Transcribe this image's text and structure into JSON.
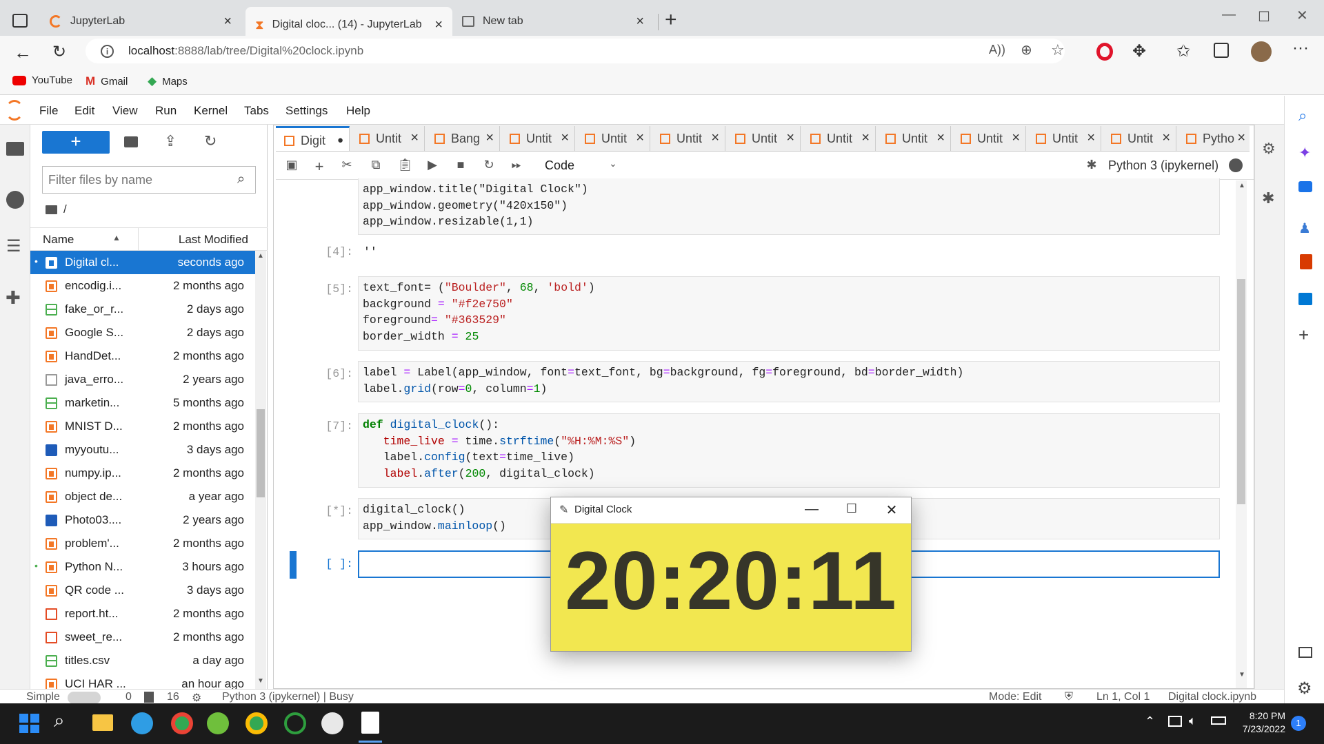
{
  "browser": {
    "tabs": [
      {
        "title": "JupyterLab",
        "close": "×"
      },
      {
        "title": "Digital cloc... (14) - JupyterLab",
        "close": "×"
      },
      {
        "title": "New tab",
        "close": "×"
      }
    ],
    "new_tab": "+",
    "address": {
      "host": "localhost",
      "path": ":8888/lab/tree/Digital%20clock.ipynb"
    },
    "bookmarks": [
      "YouTube",
      "Gmail",
      "Maps"
    ],
    "window_controls": {
      "minimize": "—",
      "maximize": "☐",
      "close": "✕"
    }
  },
  "menubar": [
    "File",
    "Edit",
    "View",
    "Run",
    "Kernel",
    "Tabs",
    "Settings",
    "Help"
  ],
  "filebrowser": {
    "new_button": "+",
    "filter_placeholder": "Filter files by name",
    "path": "/",
    "col_name": "Name",
    "col_modified": "Last Modified",
    "files": [
      {
        "name": "Digital cl...",
        "modified": "seconds ago",
        "type": "nb",
        "running": true,
        "selected": true
      },
      {
        "name": "encodig.i...",
        "modified": "2 months ago",
        "type": "nb"
      },
      {
        "name": "fake_or_r...",
        "modified": "2 days ago",
        "type": "csv"
      },
      {
        "name": "Google S...",
        "modified": "2 days ago",
        "type": "nb"
      },
      {
        "name": "HandDet...",
        "modified": "2 months ago",
        "type": "nb"
      },
      {
        "name": "java_erro...",
        "modified": "2 years ago",
        "type": "txt"
      },
      {
        "name": "marketin...",
        "modified": "5 months ago",
        "type": "csv"
      },
      {
        "name": "MNIST D...",
        "modified": "2 months ago",
        "type": "nb"
      },
      {
        "name": "myyoutu...",
        "modified": "3 days ago",
        "type": "img"
      },
      {
        "name": "numpy.ip...",
        "modified": "2 months ago",
        "type": "nb"
      },
      {
        "name": "object de...",
        "modified": "a year ago",
        "type": "nb"
      },
      {
        "name": "Photo03....",
        "modified": "2 years ago",
        "type": "img"
      },
      {
        "name": "problem'...",
        "modified": "2 months ago",
        "type": "nb"
      },
      {
        "name": "Python N...",
        "modified": "3 hours ago",
        "type": "nb",
        "running": true
      },
      {
        "name": "QR code ...",
        "modified": "3 days ago",
        "type": "nb"
      },
      {
        "name": "report.ht...",
        "modified": "2 months ago",
        "type": "html"
      },
      {
        "name": "sweet_re...",
        "modified": "2 months ago",
        "type": "html"
      },
      {
        "name": "titles.csv",
        "modified": "a day ago",
        "type": "csv"
      },
      {
        "name": "UCI HAR ...",
        "modified": "an hour ago",
        "type": "nb"
      }
    ]
  },
  "notebook_tabs": [
    {
      "title": "Digit",
      "active": true,
      "dirty": true
    },
    {
      "title": "Untit"
    },
    {
      "title": "Bang"
    },
    {
      "title": "Untit"
    },
    {
      "title": "Untit"
    },
    {
      "title": "Untit"
    },
    {
      "title": "Untit"
    },
    {
      "title": "Untit"
    },
    {
      "title": "Untit"
    },
    {
      "title": "Untit"
    },
    {
      "title": "Untit"
    },
    {
      "title": "Untit"
    },
    {
      "title": "Pytho"
    }
  ],
  "toolbar": {
    "cell_type": "Code",
    "kernel": "Python 3 (ipykernel)"
  },
  "cells": {
    "c3_l1": "app_window.title(\"Digital Clock\")",
    "c3_l2": "app_window.geometry(\"420x150\")",
    "c3_l3": "app_window.resizable(1,1)",
    "p4": "[4]:",
    "out4": "''",
    "p5": "[5]:",
    "p6": "[6]:",
    "p7": "[7]:",
    "p8": "[*]:",
    "p9": "[ ]:"
  },
  "statusbar": {
    "mode_label": "Simple",
    "zero": "0",
    "sixteen": "16",
    "kernel_status": "Python 3 (ipykernel) | Busy",
    "mode": "Mode: Edit",
    "position": "Ln 1, Col 1",
    "file": "Digital clock.ipynb"
  },
  "clock_window": {
    "title": "Digital Clock",
    "time": "20:20:11",
    "bg_color": "#f2e750",
    "fg_color": "#363529"
  },
  "taskbar": {
    "time": "8:20 PM",
    "date": "7/23/2022",
    "notifications": "1"
  }
}
